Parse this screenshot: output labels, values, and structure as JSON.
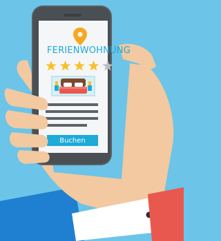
{
  "app": {
    "title": "FERIENWOHNUNG",
    "book_button_label": "Buchen"
  },
  "rating": {
    "value": 4,
    "max": 5
  },
  "icons": {
    "location": "location-pin-icon",
    "star": "star-icon",
    "bed": "bed-icon"
  },
  "colors": {
    "background": "#6cc4e8",
    "accent": "#1faad8",
    "star_filled": "#f6c02b",
    "star_empty": "#b9bec3",
    "pin": "#f6a81f",
    "phone": "#5a5f63",
    "skin": "#f2c9a0",
    "sleeve": "#e9584e",
    "shirt": "#1f7fd0"
  }
}
